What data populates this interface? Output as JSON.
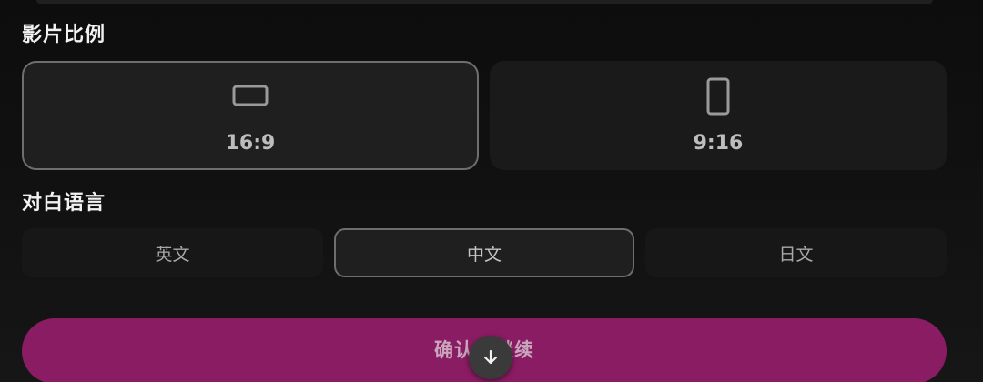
{
  "sections": {
    "aspect_ratio_title": "影片比例",
    "dialogue_language_title": "对白语言"
  },
  "aspect_ratio": {
    "selected": "16:9",
    "options": [
      {
        "label": "16:9",
        "icon": "landscape-rect-icon"
      },
      {
        "label": "9:16",
        "icon": "portrait-phone-icon"
      }
    ]
  },
  "language": {
    "selected": "中文",
    "options": [
      {
        "label": "英文"
      },
      {
        "label": "中文"
      },
      {
        "label": "日文"
      }
    ]
  },
  "confirm": {
    "label": "确认并继续"
  },
  "scroll": {
    "icon": "arrow-down-icon"
  },
  "colors": {
    "accent": "#8a1c64",
    "selected_border": "#6e6e6e",
    "background": "#0f0f0f"
  }
}
